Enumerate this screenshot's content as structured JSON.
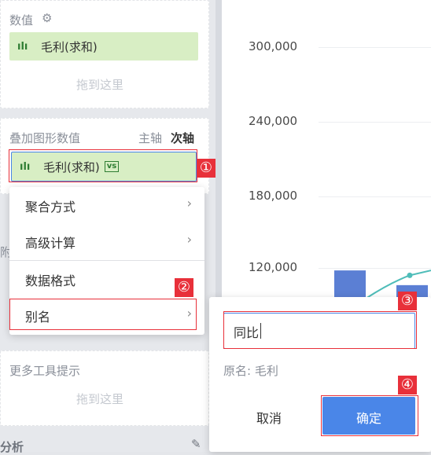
{
  "left_panel": {
    "values_section": {
      "title": "数值",
      "field": "毛利(求和)",
      "drop_hint": "拖到这里"
    },
    "overlay_section": {
      "title": "叠加图形数值",
      "axis_primary": "主轴",
      "axis_secondary": "次轴",
      "field": "毛利(求和)",
      "field_badge": "vs"
    },
    "side_peek": "附",
    "tooltip_section": {
      "title": "更多工具提示",
      "drop_hint": "拖到这里"
    },
    "analysis_section": {
      "title": "分析"
    }
  },
  "context_menu": {
    "items": [
      {
        "label": "聚合方式",
        "has_submenu": true
      },
      {
        "label": "高级计算",
        "has_submenu": true
      },
      {
        "label": "数据格式",
        "has_submenu": false
      },
      {
        "label": "别名",
        "has_submenu": true
      }
    ],
    "chevron": "›"
  },
  "rename_popup": {
    "input_value": "同比",
    "original_name": "原名: 毛利",
    "cancel_label": "取消",
    "confirm_label": "确定"
  },
  "chart_data": {
    "type": "bar",
    "y_ticks": [
      "300,000",
      "240,000",
      "180,000",
      "120,000"
    ],
    "ylim": [
      0,
      330000
    ],
    "series": [
      {
        "name": "",
        "type": "bar",
        "values": [
          118000,
          106000
        ]
      },
      {
        "name": "",
        "type": "line",
        "values": [
          null,
          114000,
          118000
        ]
      }
    ],
    "colors": {
      "bar": "#5b7fd4",
      "line": "#4fbdb9"
    }
  },
  "steps": {
    "s1": "①",
    "s2": "②",
    "s3": "③",
    "s4": "④"
  },
  "colors": {
    "accent": "#4a86e8",
    "chip_bg": "#d8eec4",
    "highlight": "#e8303a"
  }
}
